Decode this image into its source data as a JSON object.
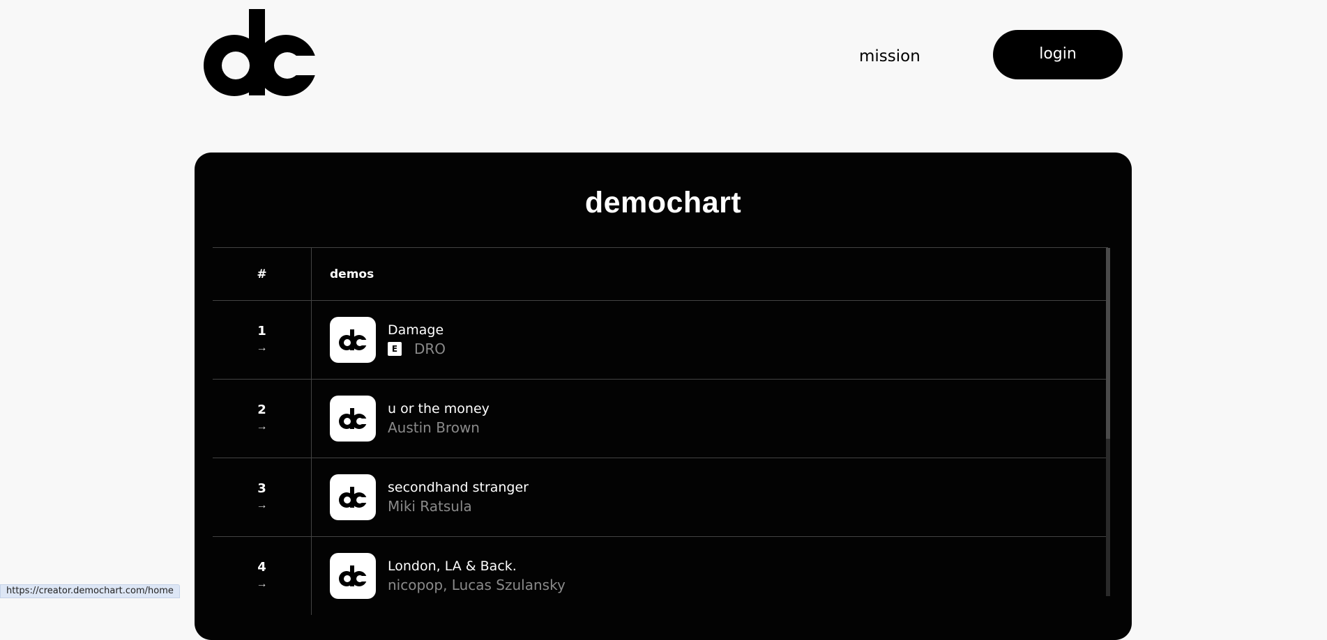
{
  "header": {
    "logo_text": "dc",
    "nav_mission": "mission",
    "login_label": "login"
  },
  "panel": {
    "title": "demochart",
    "columns": {
      "rank": "#",
      "demos": "demos"
    },
    "rows": [
      {
        "rank": "1",
        "arrow": "→",
        "title": "Damage",
        "explicit": "E",
        "artist": "DRO"
      },
      {
        "rank": "2",
        "arrow": "→",
        "title": "u or the money",
        "artist": "Austin Brown"
      },
      {
        "rank": "3",
        "arrow": "→",
        "title": "secondhand stranger",
        "artist": "Miki Ratsula"
      },
      {
        "rank": "4",
        "arrow": "→",
        "title": "London, LA & Back.",
        "artist": "nicopop, Lucas Szulansky"
      }
    ]
  },
  "status_bar": {
    "url": "https://creator.demochart.com/home"
  },
  "icons": {
    "logo": "dc-logo-icon",
    "thumb": "dc-thumbnail-icon",
    "arrow": "right-arrow-icon"
  },
  "colors": {
    "page_bg": "#f8f8f8",
    "panel_bg": "#030303",
    "artist_text": "#8a8a8a"
  }
}
